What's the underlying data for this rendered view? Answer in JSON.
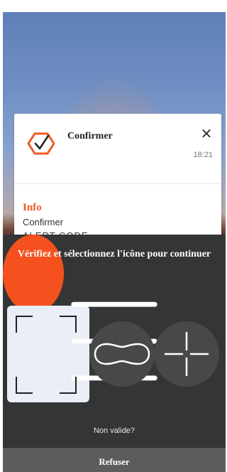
{
  "notification": {
    "title": "Confirmer",
    "time": "18:21",
    "section_label": "Info",
    "body": "Confirmer",
    "body_truncated": "ALERT CODE",
    "close_glyph": "✕",
    "logo_icon": "hexagon-check-icon",
    "accent": "#f05a23"
  },
  "panel": {
    "prompt": "Vérifiez et sélectionnez l'icône pour continuer",
    "options": [
      {
        "icon": "menu-lines-icon",
        "selected": true,
        "color": "#f4511e"
      },
      {
        "icon": "pill-shape-icon",
        "selected": false,
        "color": "#46484a"
      },
      {
        "icon": "crosshair-icon",
        "selected": false,
        "color": "#46484a"
      }
    ],
    "invalid_link": "Non valide?",
    "refuse_label": "Refuser"
  }
}
